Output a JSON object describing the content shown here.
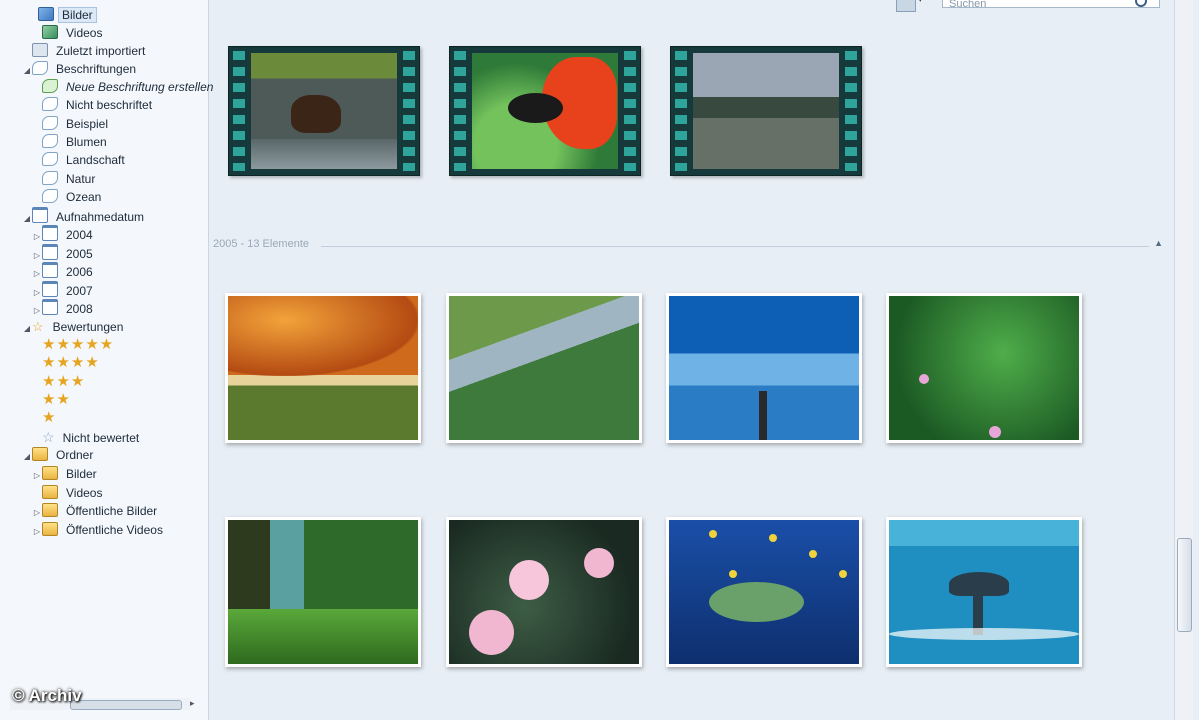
{
  "sidebar": {
    "items": [
      {
        "label": "Bilder",
        "icon": "pictures-icon",
        "arrow": "",
        "selected": true
      },
      {
        "label": "Videos",
        "icon": "videos-icon",
        "arrow": ""
      },
      {
        "label": "Zuletzt importiert",
        "icon": "recent-import-icon",
        "arrow": ""
      },
      {
        "label": "Beschriftungen",
        "icon": "tag-icon",
        "arrow": "◢"
      },
      {
        "label": "Neue Beschriftung erstellen",
        "icon": "new-tag-icon",
        "arrow": "",
        "italic": true
      },
      {
        "label": "Nicht beschriftet",
        "icon": "tag-icon",
        "arrow": ""
      },
      {
        "label": "Beispiel",
        "icon": "tag-icon",
        "arrow": ""
      },
      {
        "label": "Blumen",
        "icon": "tag-icon",
        "arrow": ""
      },
      {
        "label": "Landschaft",
        "icon": "tag-icon",
        "arrow": ""
      },
      {
        "label": "Natur",
        "icon": "tag-icon",
        "arrow": ""
      },
      {
        "label": "Ozean",
        "icon": "tag-icon",
        "arrow": ""
      },
      {
        "label": "Aufnahmedatum",
        "icon": "calendar-icon",
        "arrow": "◢"
      },
      {
        "label": "2004",
        "icon": "calendar-icon",
        "arrow": "▷"
      },
      {
        "label": "2005",
        "icon": "calendar-icon",
        "arrow": "▷"
      },
      {
        "label": "2006",
        "icon": "calendar-icon",
        "arrow": "▷"
      },
      {
        "label": "2007",
        "icon": "calendar-icon",
        "arrow": "▷"
      },
      {
        "label": "2008",
        "icon": "calendar-icon",
        "arrow": "▷"
      },
      {
        "label": "Bewertungen",
        "icon": "star-icon",
        "arrow": "◢"
      },
      {
        "label": "Nicht bewertet",
        "icon": "star-empty-icon",
        "arrow": ""
      },
      {
        "label": "Ordner",
        "icon": "folder-icon",
        "arrow": "◢"
      },
      {
        "label": "Bilder",
        "icon": "folder-icon",
        "arrow": "▷"
      },
      {
        "label": "Videos",
        "icon": "folder-icon",
        "arrow": ""
      },
      {
        "label": "Öffentliche Bilder",
        "icon": "folder-icon",
        "arrow": "▷"
      },
      {
        "label": "Öffentliche Videos",
        "icon": "folder-icon",
        "arrow": "▷"
      }
    ],
    "ratings": [
      "★★★★★",
      "★★★★",
      "★★★",
      "★★",
      "★"
    ]
  },
  "toolbar": {
    "search_placeholder": "Suchen"
  },
  "group": {
    "header": "2005 - 13 Elemente"
  },
  "watermark": "© Archiv"
}
